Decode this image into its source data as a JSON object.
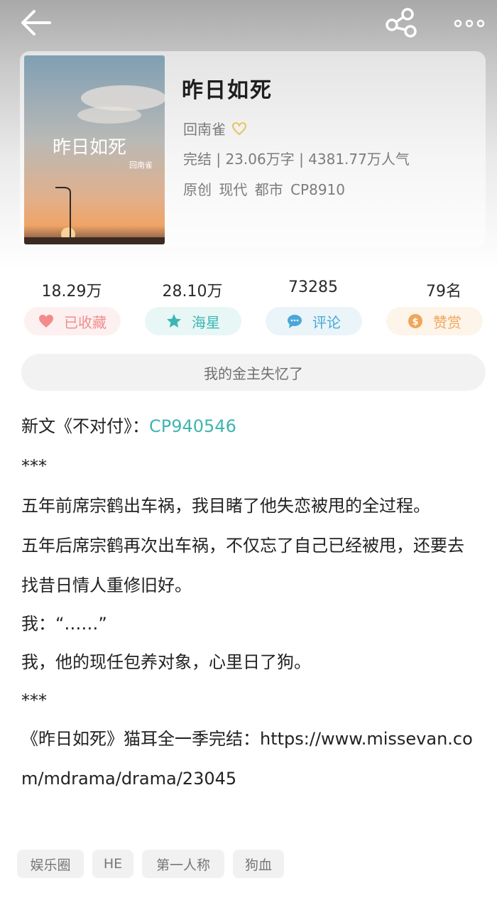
{
  "book": {
    "title": "昨日如死",
    "author": "回南雀",
    "stats": "完结 | 23.06万字 | 4381.77万人气",
    "tags": "原创  现代  都市  CP8910"
  },
  "cover": {
    "title": "昨日如死",
    "author": "回南雀"
  },
  "counts": [
    "18.29万",
    "28.10万",
    "73285",
    "79名"
  ],
  "actions": [
    {
      "label": "已收藏",
      "icon": "heart-icon",
      "color": "#f28c8c",
      "bg": "#fdf0f0"
    },
    {
      "label": "海星",
      "icon": "star-icon",
      "color": "#3ab7b2",
      "bg": "#e9f6f6"
    },
    {
      "label": "评论",
      "icon": "comment-icon",
      "color": "#4aa8d8",
      "bg": "#eaf4f9"
    },
    {
      "label": "赞赏",
      "icon": "coin-icon",
      "color": "#f0a65a",
      "bg": "#fdf4ea"
    }
  ],
  "notice": "我的金主失忆了",
  "description": {
    "line1_prefix": "新文《不对付》：",
    "line1_link": "CP940546",
    "sep1": "***",
    "p1": "五年前席宗鹤出车祸，我目睹了他失恋被甩的全过程。",
    "p2": "五年后席宗鹤再次出车祸，不仅忘了自己已经被甩，还要去找昔日情人重修旧好。",
    "p3": "我：“……”",
    "p4": "我，他的现任包养对象，心里日了狗。",
    "sep2": "***",
    "p5": "《昨日如死》猫耳全一季完结：https://www.missevan.com/mdrama/drama/23045"
  },
  "chips": [
    "娱乐圈",
    "HE",
    "第一人称",
    "狗血"
  ]
}
